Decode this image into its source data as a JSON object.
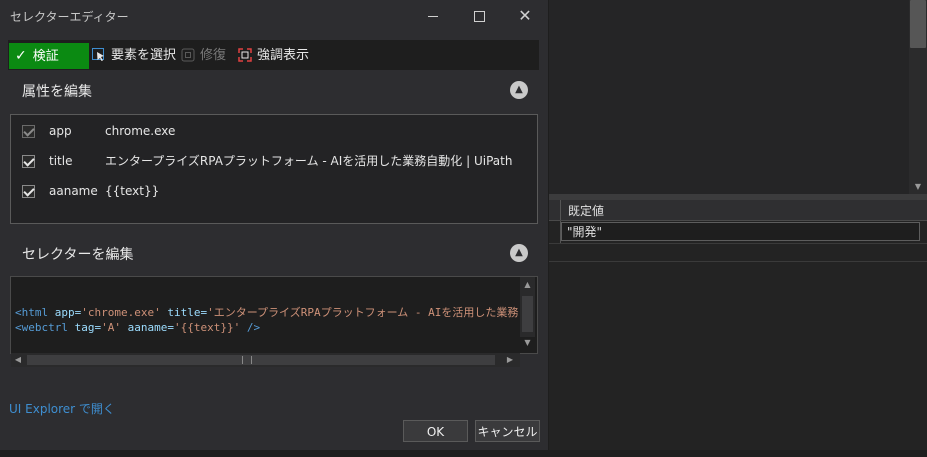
{
  "dialog": {
    "title": "セレクターエディター",
    "controls": {
      "minimize": "minimize-icon",
      "maximize": "maximize-icon",
      "close": "close-icon"
    }
  },
  "toolbar": {
    "verify_label": "検証",
    "select_element_label": "要素を選択",
    "repair_label": "修復",
    "highlight_label": "強調表示"
  },
  "attributes": {
    "title": "属性を編集",
    "rows": [
      {
        "name": "app",
        "value": "chrome.exe",
        "checked": true
      },
      {
        "name": "title",
        "value": "エンタープライズRPAプラットフォーム - AIを活用した業務自動化 | UiPath",
        "checked": true
      },
      {
        "name": "aaname",
        "value": "{{text}}",
        "checked": true
      }
    ]
  },
  "selector": {
    "title": "セレクターを編集",
    "line1": {
      "tag": "<html",
      "attr1": " app=",
      "val1": "'chrome.exe'",
      "attr2": " title=",
      "val2": "'エンタープライズRPAプラットフォーム - AIを活用した業務自動化 | UiPath"
    },
    "line2": {
      "tag": "<webctrl",
      "attr1": " tag=",
      "val1": "'A'",
      "attr2": " aaname=",
      "val2": "'{{text}}'",
      "close": " />"
    }
  },
  "footer": {
    "explorer_link": "UI Explorer で開く",
    "ok_label": "OK",
    "cancel_label": "キャンセル"
  },
  "background_panel": {
    "column_header": "既定値",
    "cell_value": "\"開発\""
  },
  "colors": {
    "verify_green": "#0b8a12",
    "link_blue": "#3e8ed0",
    "highlight_red": "#e04040"
  }
}
